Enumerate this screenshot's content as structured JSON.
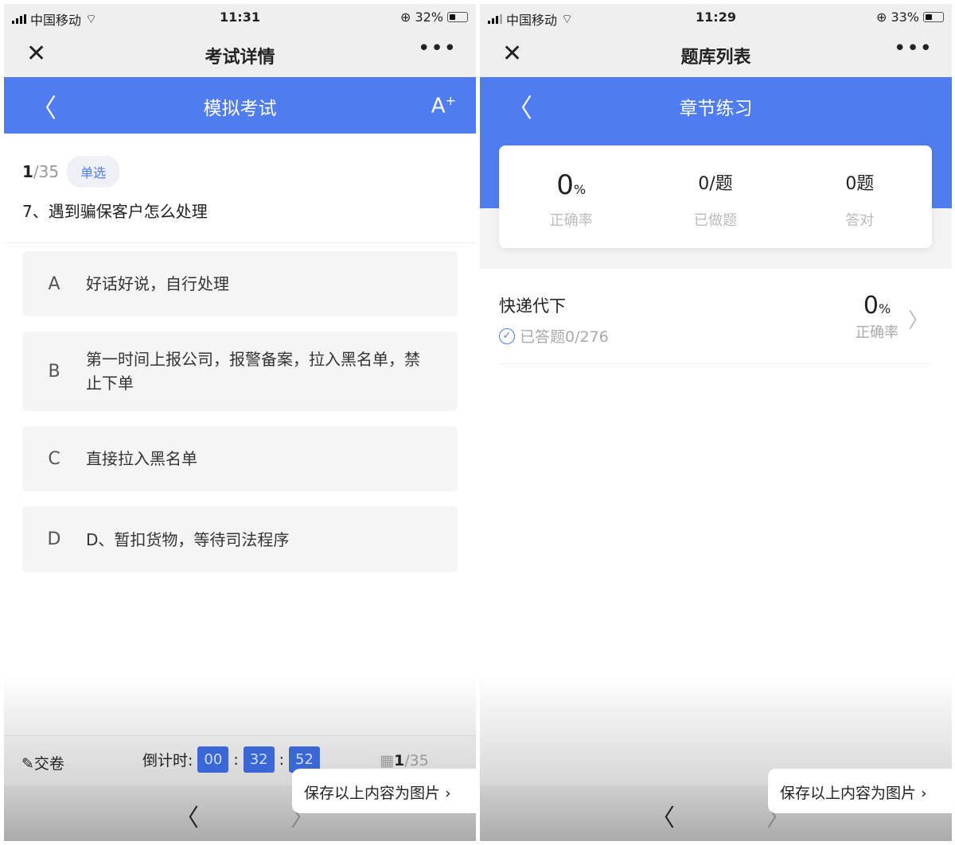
{
  "left": {
    "status": {
      "carrier": "中国移动",
      "time": "11:31",
      "battery": "32%",
      "battery_level": 0.32
    },
    "nav": {
      "title": "考试详情"
    },
    "header": {
      "title": "模拟考试",
      "font_btn": "A",
      "font_sup": "+"
    },
    "question": {
      "current": "1",
      "total": "/35",
      "type": "单选",
      "text": "7、遇到骗保客户怎么处理",
      "options": [
        {
          "key": "A",
          "text": "好话好说，自行处理"
        },
        {
          "key": "B",
          "text": "第一时间上报公司，报警备案，拉入黑名单，禁止下单"
        },
        {
          "key": "C",
          "text": "直接拉入黑名单"
        },
        {
          "key": "D",
          "text": "D、暂扣货物，等待司法程序"
        }
      ]
    },
    "toolbar": {
      "submit": "交卷",
      "countdown_label": "倒计时:",
      "hh": "00",
      "mm": "32",
      "ss": "52",
      "sep": ":",
      "page_current": "1",
      "page_total": "/35"
    },
    "save": "保存以上内容为图片 ›"
  },
  "right": {
    "status": {
      "carrier": "中国移动",
      "time": "11:29",
      "battery": "33%",
      "battery_level": 0.33
    },
    "nav": {
      "title": "题库列表"
    },
    "header": {
      "title": "章节练习"
    },
    "stats": [
      {
        "value": "0",
        "unit": "%",
        "label": "正确率"
      },
      {
        "value": "0/题",
        "unit": "",
        "label": "已做题"
      },
      {
        "value": "0题",
        "unit": "",
        "label": "答对"
      }
    ],
    "chapter": {
      "title": "快递代下",
      "answered": "已答题0/276",
      "rate": "0",
      "rate_unit": "%",
      "rate_label": "正确率"
    },
    "save": "保存以上内容为图片 ›"
  }
}
